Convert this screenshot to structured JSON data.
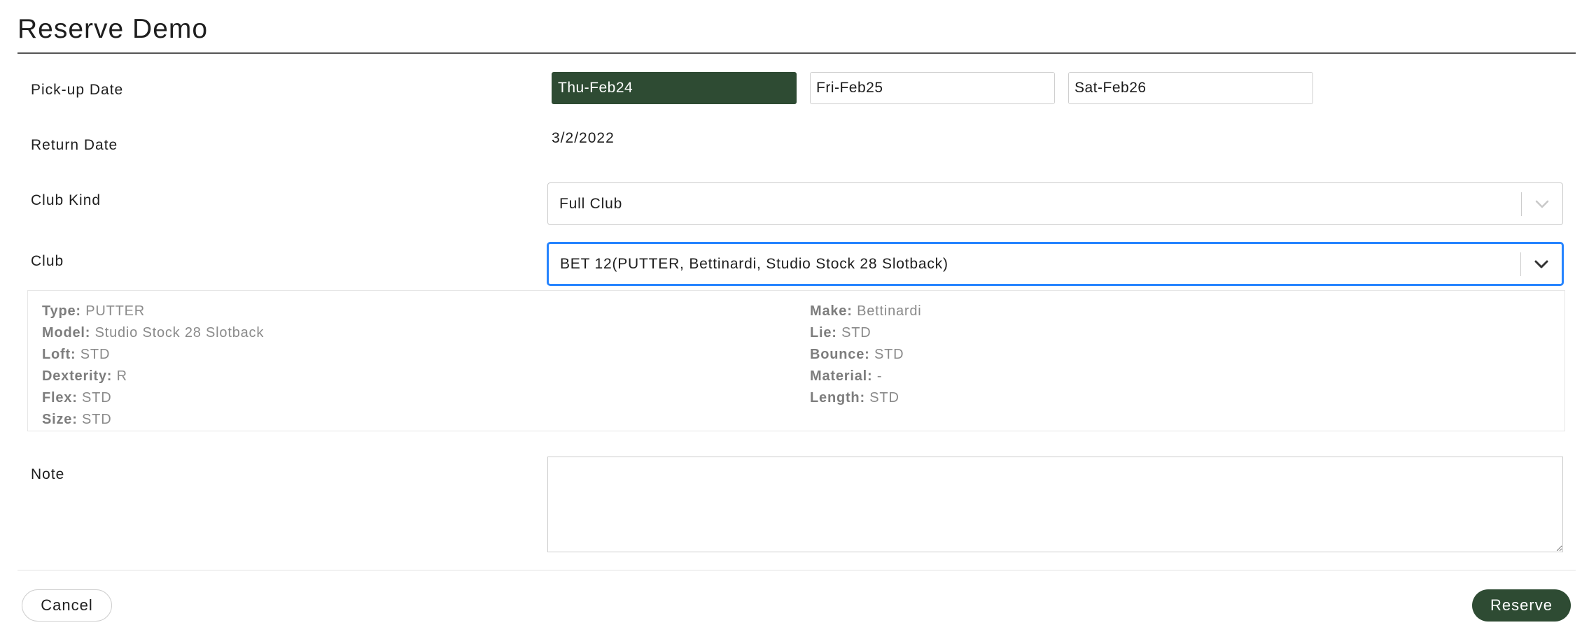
{
  "title": "Reserve Demo",
  "pickup": {
    "label": "Pick-up Date",
    "dates": [
      {
        "label": "Thu-Feb24",
        "selected": true
      },
      {
        "label": "Fri-Feb25",
        "selected": false
      },
      {
        "label": "Sat-Feb26",
        "selected": false
      }
    ]
  },
  "return_date": {
    "label": "Return Date",
    "value": "3/2/2022"
  },
  "club_kind": {
    "label": "Club Kind",
    "value": "Full Club"
  },
  "club": {
    "label": "Club",
    "value": "BET 12(PUTTER, Bettinardi, Studio Stock 28 Slotback)"
  },
  "details": {
    "left": [
      {
        "key": "Type:",
        "value": "PUTTER"
      },
      {
        "key": "Model:",
        "value": "Studio Stock 28 Slotback"
      },
      {
        "key": "Loft:",
        "value": "STD"
      },
      {
        "key": "Dexterity:",
        "value": "R"
      },
      {
        "key": "Flex:",
        "value": "STD"
      },
      {
        "key": "Size:",
        "value": "STD"
      }
    ],
    "right": [
      {
        "key": "Make:",
        "value": "Bettinardi"
      },
      {
        "key": "Lie:",
        "value": "STD"
      },
      {
        "key": "Bounce:",
        "value": "STD"
      },
      {
        "key": "Material:",
        "value": "-"
      },
      {
        "key": "Length:",
        "value": "STD"
      }
    ]
  },
  "note": {
    "label": "Note",
    "value": ""
  },
  "footer": {
    "cancel_label": "Cancel",
    "reserve_label": "Reserve"
  },
  "colors": {
    "accent": "#2e4b33",
    "focus": "#2684ff"
  },
  "icons": {
    "select_indicator": "chevron-down-icon"
  }
}
